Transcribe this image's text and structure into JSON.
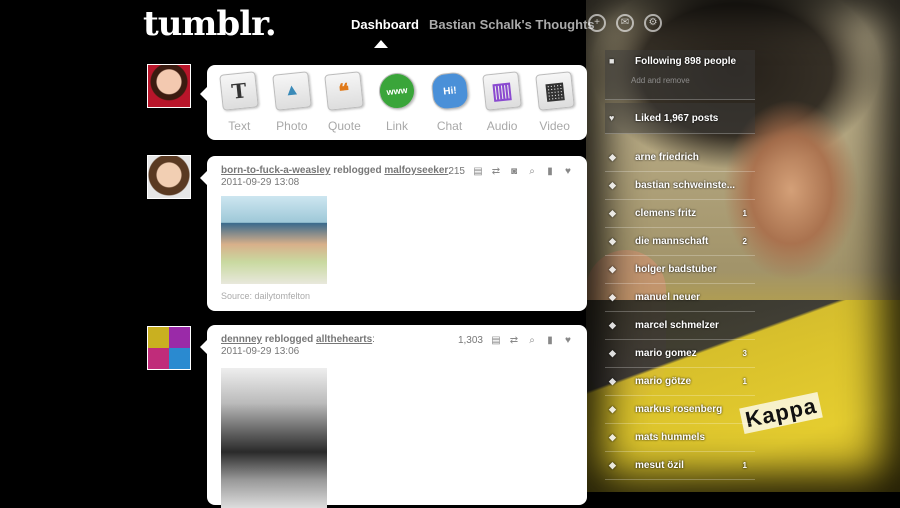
{
  "header": {
    "logo": "tumblr.",
    "nav_dashboard": "Dashboard",
    "nav_blog": "Bastian Schalk's Thoughts"
  },
  "post_types": [
    {
      "label": "Text",
      "glyph": "T",
      "icon": "text-icon"
    },
    {
      "label": "Photo",
      "glyph": "▲",
      "icon": "photo-icon"
    },
    {
      "label": "Quote",
      "glyph": "❝",
      "icon": "quote-icon"
    },
    {
      "label": "Link",
      "glyph": "www",
      "icon": "link-icon"
    },
    {
      "label": "Chat",
      "glyph": "Hi!",
      "icon": "chat-icon"
    },
    {
      "label": "Audio",
      "glyph": "▥",
      "icon": "audio-icon"
    },
    {
      "label": "Video",
      "glyph": "▦",
      "icon": "video-icon"
    }
  ],
  "posts": [
    {
      "author": "born-to-fuck-a-weasley",
      "verb": "reblogged",
      "source_user": "malfoyseeker",
      "date": "2011-09-29 13:08",
      "notes": "215",
      "source_text": "Source: dailytomfelton"
    },
    {
      "author": "dennney",
      "verb": "reblogged",
      "source_user": "allthehearts",
      "date": "2011-09-29 13:06",
      "notes": "1,303"
    }
  ],
  "sidebar": {
    "following": "Following 898 people",
    "add_remove": "Add and remove",
    "liked": "Liked 1,967 posts",
    "tags": [
      {
        "label": "arne friedrich",
        "count": ""
      },
      {
        "label": "bastian schweinste...",
        "count": ""
      },
      {
        "label": "clemens fritz",
        "count": "1"
      },
      {
        "label": "die mannschaft",
        "count": "2"
      },
      {
        "label": "holger badstuber",
        "count": ""
      },
      {
        "label": "manuel neuer",
        "count": ""
      },
      {
        "label": "marcel schmelzer",
        "count": ""
      },
      {
        "label": "mario gomez",
        "count": "3"
      },
      {
        "label": "mario götze",
        "count": "1"
      },
      {
        "label": "markus rosenberg",
        "count": ""
      },
      {
        "label": "mats hummels",
        "count": ""
      },
      {
        "label": "mesut özil",
        "count": "1"
      }
    ]
  },
  "background": {
    "shirt_logo": "Kappa"
  }
}
